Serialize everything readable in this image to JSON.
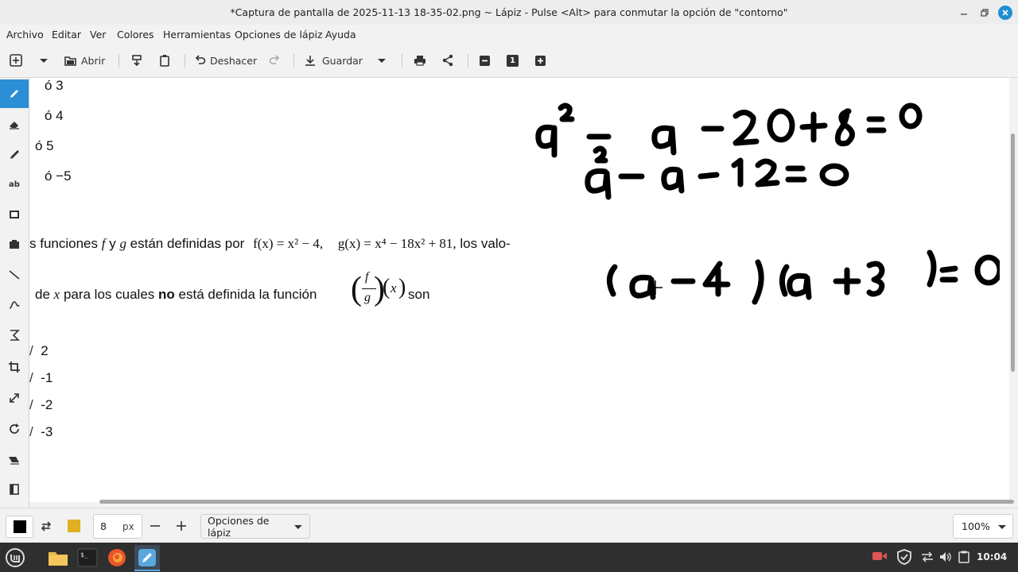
{
  "window": {
    "title": "*Captura de pantalla de 2025-11-13 18-35-02.png ~ Lápiz - Pulse <Alt> para conmutar la opción de \"contorno\""
  },
  "menu": [
    "Archivo",
    "Editar",
    "Ver",
    "Colores",
    "Herramientas",
    "Opciones de lápiz",
    "Ayuda"
  ],
  "toolbar": {
    "open_label": "Abrir",
    "undo_label": "Deshacer",
    "save_label": "Guardar",
    "zoom_reset_label": "1"
  },
  "tools": [
    "pencil",
    "eraser",
    "highlighter",
    "text",
    "rectangle-select",
    "free-select",
    "line",
    "curve",
    "shape",
    "crop",
    "scale",
    "rotate",
    "filters",
    "skew"
  ],
  "document": {
    "options_top": [
      "ó   3",
      "ó   4",
      "ó   5",
      "ó   −5"
    ],
    "question_line1_prefix": "s funciones",
    "question_line1_and": "y",
    "question_line1_defined": "están definidas por",
    "f_func": "f(x) = x² − 4,",
    "g_func": "g(x) = x⁴ − 18x² + 81,",
    "question_line1_suffix": "los valo-",
    "question_line2_prefix": "de",
    "question_line2_mid": "para los cuales",
    "question_line2_bold": "no",
    "question_line2_rest": "está definida la función",
    "question_line2_suffix": "son",
    "var_f": "f",
    "var_g": "g",
    "var_x": "x",
    "answers": [
      "2",
      "-1",
      "-2",
      "-3"
    ],
    "handwriting": [
      "a² − a − 20 + 8 = 0",
      "a² − a − 12 = 0",
      "(a − 4)(a + 3) = 0"
    ]
  },
  "bottombar": {
    "size_value": "8",
    "size_unit": "px",
    "options_label": "Opciones de lápiz",
    "zoom_label": "100%",
    "primary_color": "#000000",
    "secondary_color": "#e0b020"
  },
  "taskbar": {
    "clock": "10:04"
  }
}
